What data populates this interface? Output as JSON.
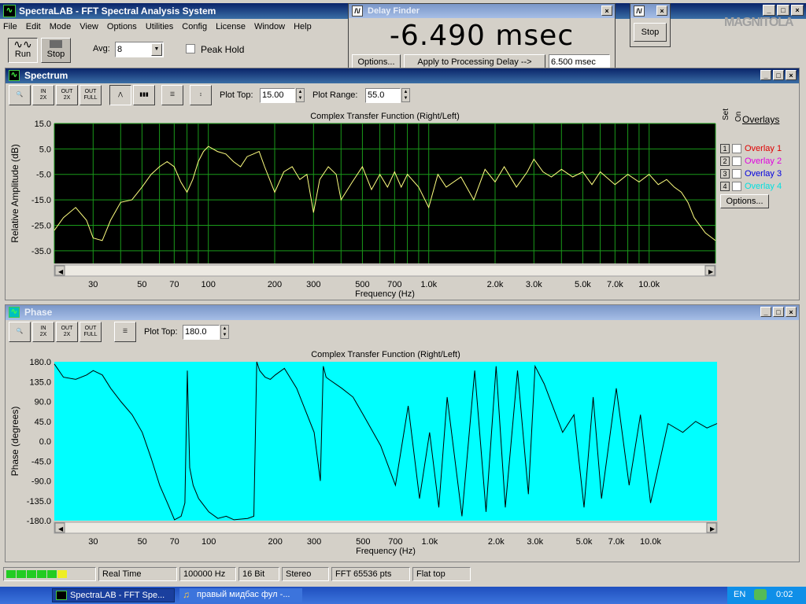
{
  "app": {
    "title": "SpectraLAB - FFT Spectral Analysis System",
    "menu": [
      "File",
      "Edit",
      "Mode",
      "View",
      "Options",
      "Utilities",
      "Config",
      "License",
      "Window",
      "Help"
    ],
    "run_label": "Run",
    "stop_label": "Stop",
    "avg_label": "Avg:",
    "avg_value": "8",
    "peak_hold_label": "Peak Hold",
    "watermark": "MAGNITOLA"
  },
  "delay_finder": {
    "title": "Delay Finder",
    "readout": "-6.490 msec",
    "options_label": "Options...",
    "apply_label": "Apply to Processing Delay -->",
    "delay_value": "6.500 msec"
  },
  "stop_window": {
    "stop_label": "Stop"
  },
  "spectrum": {
    "title": "Spectrum",
    "plot_top_label": "Plot Top:",
    "plot_top_value": "15.00",
    "plot_range_label": "Plot Range:",
    "plot_range_value": "55.0",
    "chart_title": "Complex Transfer Function (Right/Left)",
    "ylabel": "Relative Amplitude (dB)",
    "xlabel": "Frequency (Hz)",
    "yticks": [
      "15.0",
      "5.0",
      "-5.0",
      "-15.0",
      "-25.0",
      "-35.0"
    ],
    "xticks": [
      "30",
      "50",
      "70",
      "100",
      "200",
      "300",
      "500",
      "700",
      "1.0k",
      "2.0k",
      "3.0k",
      "5.0k",
      "7.0k",
      "10.0k"
    ],
    "overlays": {
      "header_set": "Set",
      "header_on": "On",
      "header": "Overlays",
      "items": [
        {
          "num": "1",
          "label": "Overlay 1",
          "color": "#e00000"
        },
        {
          "num": "2",
          "label": "Overlay 2",
          "color": "#e000e0"
        },
        {
          "num": "3",
          "label": "Overlay 3",
          "color": "#0000e0"
        },
        {
          "num": "4",
          "label": "Overlay 4",
          "color": "#00e0e0"
        }
      ],
      "options_label": "Options..."
    }
  },
  "phase": {
    "title": "Phase",
    "plot_top_label": "Plot Top:",
    "plot_top_value": "180.0",
    "chart_title": "Complex Transfer Function (Right/Left)",
    "ylabel": "Phase (degrees)",
    "xlabel": "Frequency (Hz)",
    "yticks": [
      "180.0",
      "135.0",
      "90.0",
      "45.0",
      "0.0",
      "-45.0",
      "-90.0",
      "-135.0",
      "-180.0"
    ],
    "xticks": [
      "30",
      "50",
      "70",
      "100",
      "200",
      "300",
      "500",
      "700",
      "1.0k",
      "2.0k",
      "3.0k",
      "5.0k",
      "7.0k",
      "10.0k"
    ]
  },
  "chart_data": [
    {
      "type": "line",
      "title": "Complex Transfer Function (Right/Left)",
      "xlabel": "Frequency (Hz)",
      "ylabel": "Relative Amplitude (dB)",
      "xscale": "log",
      "xlim": [
        20,
        20000
      ],
      "ylim": [
        -40,
        15
      ],
      "grid": true,
      "background": "#000000",
      "line_color": "#ffff80",
      "x": [
        20,
        22,
        25,
        28,
        30,
        33,
        36,
        40,
        45,
        50,
        55,
        60,
        65,
        70,
        75,
        80,
        85,
        90,
        95,
        100,
        110,
        120,
        130,
        140,
        150,
        160,
        170,
        180,
        200,
        220,
        240,
        260,
        280,
        300,
        320,
        350,
        380,
        400,
        450,
        500,
        550,
        600,
        650,
        700,
        750,
        800,
        900,
        1000,
        1100,
        1200,
        1400,
        1600,
        1800,
        2000,
        2200,
        2500,
        2800,
        3000,
        3300,
        3600,
        4000,
        4500,
        5000,
        5500,
        6000,
        7000,
        8000,
        9000,
        10000,
        11000,
        12000,
        13000,
        14000,
        15000,
        16000,
        18000,
        20000
      ],
      "y": [
        -27,
        -22,
        -18,
        -23,
        -30,
        -31,
        -23,
        -16,
        -15,
        -10,
        -5,
        -2,
        0,
        -2,
        -8,
        -12,
        -7,
        0,
        4,
        6,
        4,
        3,
        0,
        -2,
        2,
        3,
        4,
        -2,
        -12,
        -4,
        -2,
        -7,
        -5,
        -20,
        -7,
        -2,
        -5,
        -15,
        -8,
        -2,
        -11,
        -5,
        -10,
        -4,
        -10,
        -5,
        -10,
        -18,
        -5,
        -10,
        -6,
        -15,
        -3,
        -8,
        -2,
        -10,
        -4,
        1,
        -4,
        -6,
        -3,
        -6,
        -4,
        -9,
        -4,
        -9,
        -5,
        -8,
        -5,
        -9,
        -7,
        -10,
        -12,
        -16,
        -22,
        -28,
        -31
      ]
    },
    {
      "type": "line",
      "title": "Complex Transfer Function (Right/Left)",
      "xlabel": "Frequency (Hz)",
      "ylabel": "Phase (degrees)",
      "xscale": "log",
      "xlim": [
        20,
        20000
      ],
      "ylim": [
        -180,
        180
      ],
      "grid": false,
      "background": "#00ffff",
      "line_color": "#000000",
      "x": [
        20,
        22,
        25,
        28,
        30,
        33,
        36,
        40,
        45,
        50,
        55,
        60,
        65,
        70,
        75,
        78,
        80,
        82,
        85,
        90,
        100,
        110,
        120,
        130,
        150,
        160,
        165,
        170,
        180,
        190,
        200,
        220,
        250,
        300,
        320,
        330,
        340,
        350,
        400,
        450,
        500,
        600,
        700,
        800,
        900,
        1000,
        1100,
        1200,
        1400,
        1600,
        1800,
        2000,
        2200,
        2500,
        2800,
        3000,
        3300,
        3600,
        4000,
        4500,
        5000,
        5500,
        6000,
        7000,
        8000,
        9000,
        10000,
        12000,
        14000,
        16000,
        18000,
        20000
      ],
      "y": [
        175,
        145,
        140,
        150,
        160,
        150,
        120,
        90,
        60,
        20,
        -40,
        -100,
        -140,
        -178,
        -170,
        -140,
        160,
        -60,
        -100,
        -130,
        -160,
        -175,
        -170,
        -178,
        -175,
        -170,
        180,
        160,
        145,
        140,
        150,
        165,
        120,
        20,
        -90,
        170,
        145,
        140,
        120,
        100,
        60,
        -10,
        -100,
        80,
        -130,
        20,
        -150,
        100,
        -170,
        160,
        -160,
        170,
        -150,
        160,
        -120,
        170,
        130,
        80,
        20,
        60,
        -150,
        100,
        -130,
        120,
        -100,
        60,
        -140,
        40,
        20,
        45,
        30,
        40
      ]
    }
  ],
  "status_bar": {
    "mode": "Real Time",
    "rate": "100000 Hz",
    "bits": "16 Bit",
    "channels": "Stereo",
    "fft": "FFT 65536 pts",
    "window": "Flat top"
  },
  "taskbar": {
    "task1": "SpectraLAB - FFT Spe...",
    "task2": "правый мидбас фул -...",
    "lang": "EN",
    "clock": "0:02"
  }
}
